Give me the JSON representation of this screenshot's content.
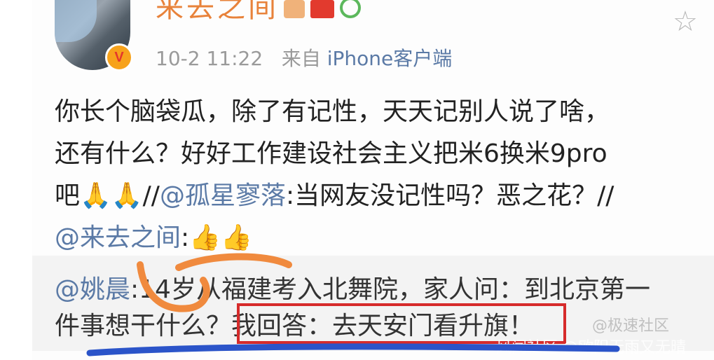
{
  "post": {
    "username": "来去之间",
    "timestamp": "10-2 11:22",
    "source_prefix": "来自",
    "source": "iPhone客户端",
    "avatar_badge": "V",
    "body": {
      "line1": "你长个脑袋瓜，除了有记性，天天记别人说了啥，",
      "line2": "还有什么？好好工作建设社会主义把米6换米9pro",
      "line3_a": "吧",
      "line3_emoji": "🙏🙏",
      "line3_b": "//",
      "line3_mention": "@孤星寥落",
      "line3_c": ":当网友没记性吗？恶之花？//",
      "line4_mention": "@来去之间",
      "line4_c": ":",
      "line4_emoji": "👍👍"
    }
  },
  "retweet": {
    "mention": "@姚晨",
    "text_a": ":14岁从福建考入北舞院，家人问：到北京第一",
    "text_b": "件事想干什么？",
    "highlight": "我回答：去天安门看升旗！"
  },
  "watermark": {
    "logo_text": "@极速社区",
    "credit": "风闻社区 @欧阳无雨又无晴"
  },
  "colors": {
    "mention": "#5b7aa6",
    "highlight_box": "#d62b2b",
    "annotation_stroke": "#f08a3e"
  },
  "icons": [
    "favorite-star-icon",
    "verified-badge-icon",
    "member-badge-icon",
    "flag-badge-icon",
    "circle-badge-icon"
  ]
}
